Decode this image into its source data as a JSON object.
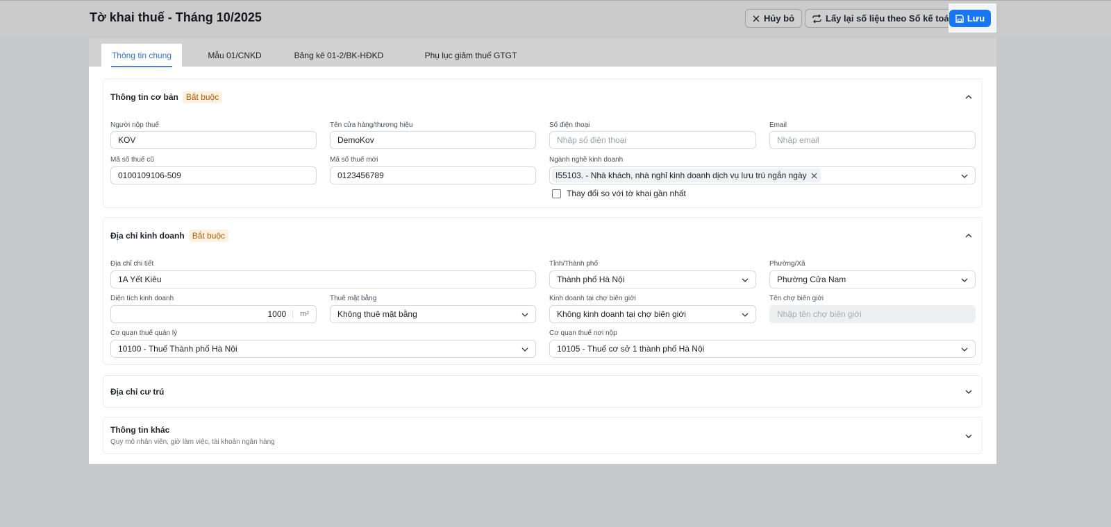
{
  "header": {
    "title": "Tờ khai thuế - Tháng 10/2025",
    "cancel": "Hủy bỏ",
    "reload": "Lấy lại số liệu theo Sổ kế toán",
    "save": "Lưu"
  },
  "tabs": [
    "Thông tin chung",
    "Mẫu 01/CNKD",
    "Bảng kê 01-2/BK-HĐKD",
    "Phụ lục giảm thuế GTGT"
  ],
  "basic": {
    "title": "Thông tin cơ bản",
    "badge": "Bắt buộc",
    "taxpayer_label": "Người nộp thuế",
    "taxpayer": "KOV",
    "store_label": "Tên cửa hàng/thương hiệu",
    "store": "DemoKov",
    "phone_label": "Số điện thoại",
    "phone_ph": "Nhập số điện thoại",
    "email_label": "Email",
    "email_ph": "Nhập email",
    "old_tax_label": "Mã số thuế cũ",
    "old_tax": "0100109106-509",
    "new_tax_label": "Mã số thuế mới",
    "new_tax": "0123456789",
    "industry_label": "Ngành nghề kinh doanh",
    "industry_tag": "I55103. - Nhà khách, nhà nghỉ kinh doanh dịch vụ lưu trú ngắn ngày",
    "change_label": "Thay đổi so với tờ khai gần nhất"
  },
  "address": {
    "title": "Địa chỉ kinh doanh",
    "badge": "Bắt buộc",
    "detail_label": "Địa chỉ chi tiết",
    "detail": "1A Yết Kiêu",
    "province_label": "Tỉnh/Thành phố",
    "province": "Thành phố Hà Nội",
    "ward_label": "Phường/Xã",
    "ward": "Phường Cửa Nam",
    "area_label": "Diện tích kinh doanh",
    "area": "1000",
    "area_unit": "m²",
    "rent_label": "Thuê mặt bằng",
    "rent": "Không thuê mặt bằng",
    "border_label": "Kinh doanh tại chợ biên giới",
    "border": "Không kinh doanh tại chợ biên giới",
    "market_label": "Tên chợ biên giới",
    "market_ph": "Nhập tên chợ biên giới",
    "mgr_label": "Cơ quan thuế quản lý",
    "mgr": "10100 - Thuế Thành phố Hà Nội",
    "pay_label": "Cơ quan thuế nơi nộp",
    "pay": "10105 - Thuế cơ sở 1 thành phố Hà Nội"
  },
  "residence": {
    "title": "Địa chỉ cư trú"
  },
  "other": {
    "title": "Thông tin khác",
    "subtitle": "Quy mô nhân viên, giờ làm việc, tài khoản ngân hàng"
  }
}
